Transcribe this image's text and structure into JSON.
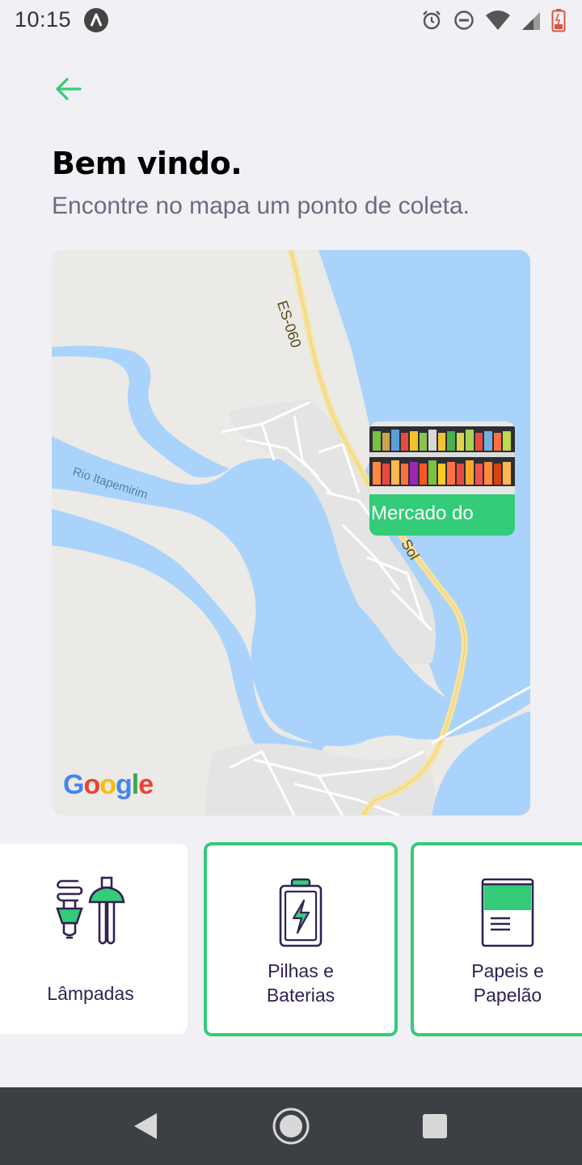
{
  "status_bar": {
    "time": "10:15"
  },
  "header": {
    "title": "Bem vindo.",
    "subtitle": "Encontre no mapa um ponto de coleta."
  },
  "map": {
    "road_label": "ES-060",
    "road_label_2": "Sol",
    "river_label": "Rio Itapemirim",
    "google_logo": "Google",
    "marker": {
      "name": "Mercado do"
    }
  },
  "categories": [
    {
      "label_line1": "Lâmpadas",
      "label_line2": "",
      "selected": false,
      "icon": "lamp-icon"
    },
    {
      "label_line1": "Pilhas e",
      "label_line2": "Baterias",
      "selected": true,
      "icon": "battery-icon"
    },
    {
      "label_line1": "Papeis e",
      "label_line2": "Papelão",
      "selected": true,
      "icon": "paper-icon"
    }
  ],
  "colors": {
    "accent": "#34cb79",
    "title": "#000000",
    "subtitle": "#6c6c80",
    "background": "#f0f0f5",
    "text_dark": "#322153"
  }
}
